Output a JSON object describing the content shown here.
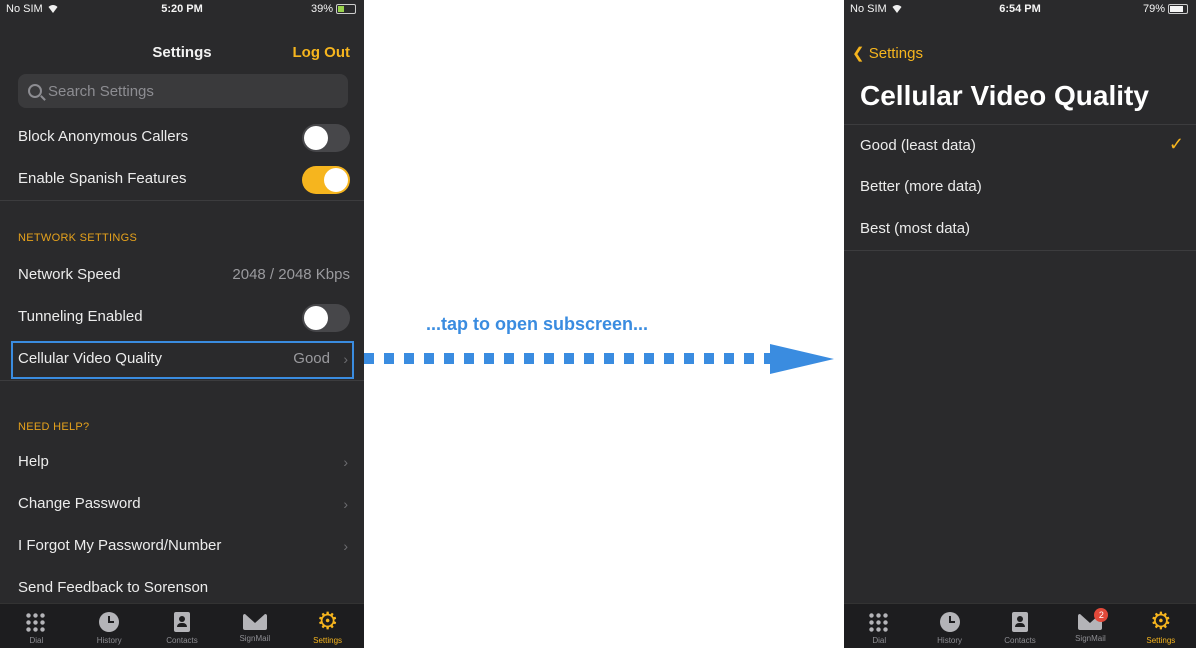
{
  "left_screen": {
    "status": {
      "carrier": "No SIM",
      "time": "5:20 PM",
      "battery": "39%",
      "battery_level": 0.39
    },
    "title": "Settings",
    "logout": "Log Out",
    "search_placeholder": "Search Settings",
    "rows_top": [
      {
        "label": "Block Anonymous Callers",
        "toggle": "off"
      },
      {
        "label": "Enable Spanish Features",
        "toggle": "on"
      }
    ],
    "network_header": "NETWORK SETTINGS",
    "network": {
      "speed_label": "Network Speed",
      "speed_value": "2048 / 2048 Kbps",
      "tunneling_label": "Tunneling Enabled",
      "tunneling_toggle": "off",
      "cellular_label": "Cellular Video Quality",
      "cellular_value": "Good"
    },
    "help_header": "NEED HELP?",
    "help_items": [
      "Help",
      "Change Password",
      "I Forgot My Password/Number",
      "Send Feedback to Sorenson"
    ],
    "tabs": [
      "Dial",
      "History",
      "Contacts",
      "SignMail",
      "Settings"
    ],
    "active_tab": "Settings"
  },
  "caption": "...tap to open subscreen...",
  "right_screen": {
    "status": {
      "carrier": "No SIM",
      "time": "6:54 PM",
      "battery": "79%",
      "battery_level": 0.79
    },
    "back_label": "Settings",
    "title": "Cellular Video Quality",
    "options": [
      "Good (least data)",
      "Better (more data)",
      "Best (most data)"
    ],
    "selected_option": "Good (least data)",
    "tabs": [
      "Dial",
      "History",
      "Contacts",
      "SignMail",
      "Settings"
    ],
    "signmail_badge": "2",
    "active_tab": "Settings"
  },
  "colors": {
    "accent": "#f6b51e",
    "annotation": "#3a8ce0",
    "background": "#2a2a2c"
  }
}
